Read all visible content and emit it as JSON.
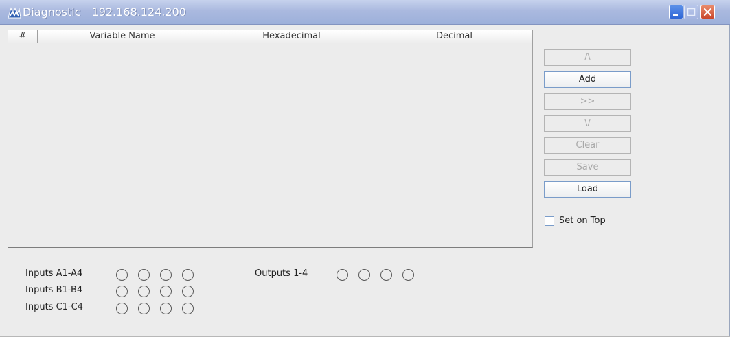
{
  "window": {
    "title": "Diagnostic",
    "address": "192.168.124.200",
    "buttons": {
      "minimize": "minimize",
      "maximize": "maximize",
      "close": "close"
    }
  },
  "table": {
    "columns": [
      "#",
      "Variable Name",
      "Hexadecimal",
      "Decimal"
    ],
    "rows": []
  },
  "side_buttons": {
    "up": {
      "label": "/\\",
      "enabled": false
    },
    "add": {
      "label": "Add",
      "enabled": true
    },
    "forward": {
      "label": ">>",
      "enabled": false
    },
    "down": {
      "label": "\\/",
      "enabled": false
    },
    "clear": {
      "label": "Clear",
      "enabled": false
    },
    "save": {
      "label": "Save",
      "enabled": false
    },
    "load": {
      "label": "Load",
      "enabled": true
    }
  },
  "set_on_top": {
    "label": "Set on Top",
    "checked": false
  },
  "io": {
    "inputs_a": {
      "label": "Inputs A1-A4",
      "states": [
        false,
        false,
        false,
        false
      ]
    },
    "inputs_b": {
      "label": "Inputs B1-B4",
      "states": [
        false,
        false,
        false,
        false
      ]
    },
    "inputs_c": {
      "label": "Inputs C1-C4",
      "states": [
        false,
        false,
        false,
        false
      ]
    },
    "outputs": {
      "label": "Outputs 1-4",
      "states": [
        false,
        false,
        false,
        false
      ]
    }
  },
  "icons": {
    "app": "diagnostic-app-icon",
    "minimize": "minimize-icon",
    "maximize": "maximize-icon",
    "close": "close-icon"
  },
  "colors": {
    "titlebar": "#aab9df",
    "window_bg": "#ececec",
    "enabled_border": "#7a9cc9",
    "disabled_text": "#a8a8a8"
  }
}
